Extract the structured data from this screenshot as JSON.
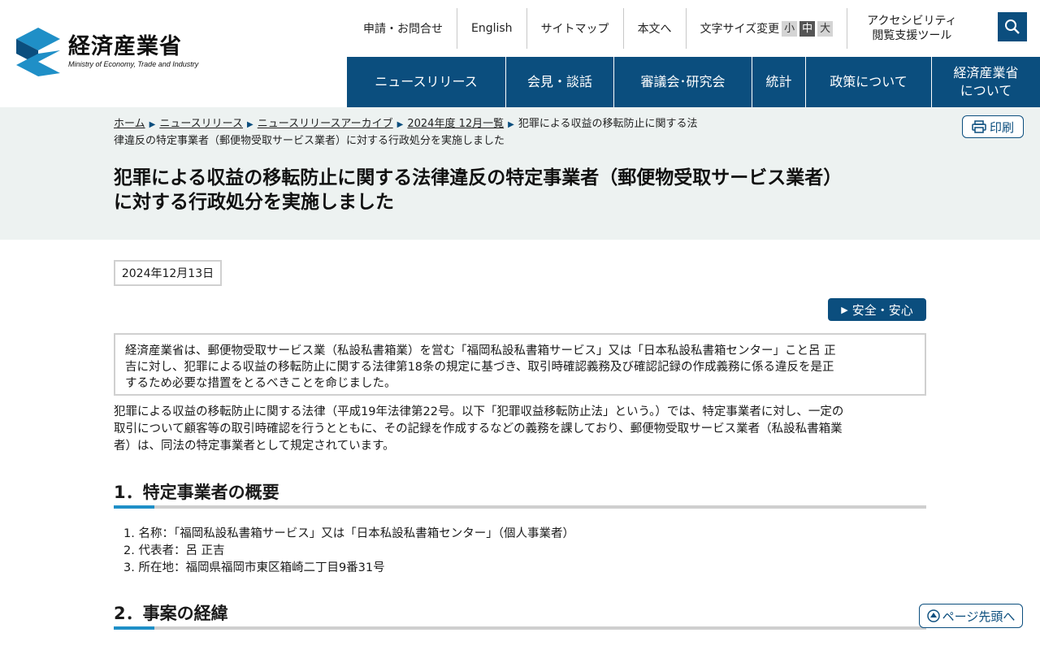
{
  "header": {
    "logo_jp": "経済産業省",
    "logo_en": "Ministry of Economy, Trade and Industry",
    "utility": {
      "inquiry": "申請・お問合せ",
      "english": "English",
      "sitemap": "サイトマップ",
      "skip": "本文へ",
      "font_size_label": "文字サイズ変更",
      "font_small": "小",
      "font_medium": "中",
      "font_large": "大",
      "a11y_line1": "アクセシビリティ",
      "a11y_line2": "閲覧支援ツール"
    },
    "nav": [
      {
        "label": "ニュースリリース"
      },
      {
        "label": "会見・談話"
      },
      {
        "label": "審議会･研究会"
      },
      {
        "label": "統計"
      },
      {
        "label": "政策について"
      },
      {
        "label": "経済産業省について"
      }
    ],
    "nav_last_line1": "経済産業省",
    "nav_last_line2": "について"
  },
  "breadcrumb": {
    "home": "ホーム",
    "news": "ニュースリリース",
    "archive": "ニュースリリースアーカイブ",
    "month": "2024年度 12月一覧",
    "current_a": "犯罪による収益の移転防止に関する法",
    "current_b": "律違反の特定事業者（郵便物受取サービス業者）に対する行政処分を実施しました"
  },
  "print_label": "印刷",
  "title_line1": "犯罪による収益の移転防止に関する法律違反の特定事業者（郵便物受取サービス業者）",
  "title_line2": "に対する行政処分を実施しました",
  "date": "2024年12月13日",
  "tag": "安全・安心",
  "summary_line1": "経済産業省は、郵便物受取サービス業（私設私書箱業）を営む「福岡私設私書箱サービス」又は「日本私設私書箱センター」こと呂 正",
  "summary_line2": "吉に対し、犯罪による収益の移転防止に関する法律第18条の規定に基づき、取引時確認義務及び確認記録の作成義務に係る違反を是正",
  "summary_line3": "するため必要な措置をとるべきことを命じました。",
  "intro_line1": "犯罪による収益の移転防止に関する法律（平成19年法律第22号。以下「犯罪収益移転防止法」という。）では、特定事業者に対し、一定の",
  "intro_line2": "取引について顧客等の取引時確認を行うとともに、その記録を作成するなどの義務を課しており、郵便物受取サービス業者（私設私書箱業",
  "intro_line3": "者）は、同法の特定事業者として規定されています。",
  "section1": "1．特定事業者の概要",
  "section1_items": [
    "1. 名称：「福岡私設私書箱サービス」又は「日本私設私書箱センター」（個人事業者）",
    "2. 代表者：呂 正吉",
    "3. 所在地：福岡県福岡市東区箱崎二丁目9番31号"
  ],
  "section2": "2．事案の経緯",
  "pagetop": "ページ先頭へ",
  "colors": {
    "brand": "#0b4e7e",
    "accent": "#1f8fc7",
    "band": "#edf2f1"
  }
}
